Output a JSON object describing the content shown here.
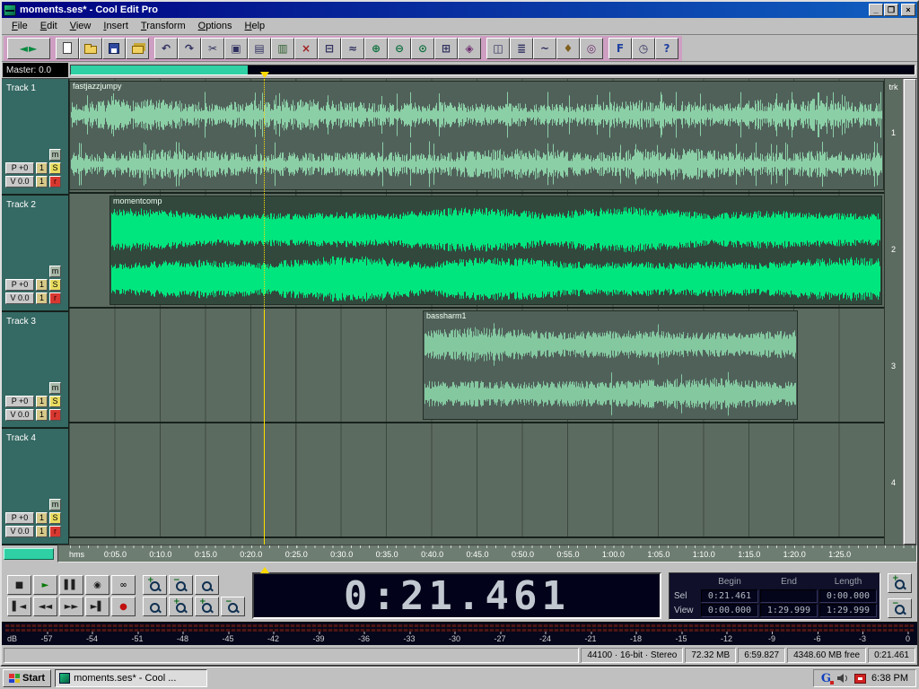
{
  "window": {
    "title": "moments.ses* - Cool Edit Pro",
    "minimize": "_",
    "maximize": "❐",
    "close": "×"
  },
  "menu": [
    "File",
    "Edit",
    "View",
    "Insert",
    "Transform",
    "Options",
    "Help"
  ],
  "toolbar": {
    "groups": [
      {
        "name": "view",
        "buttons": [
          {
            "name": "multitrack-view-toggle",
            "glyph": "◄►",
            "color": "#0a8a40",
            "wide": true
          }
        ]
      },
      {
        "name": "file",
        "buttons": [
          {
            "name": "new-session",
            "icon": "page"
          },
          {
            "name": "open-file",
            "icon": "folder"
          },
          {
            "name": "save-session",
            "icon": "floppy"
          },
          {
            "name": "save-all",
            "icon": "folders"
          }
        ]
      },
      {
        "name": "edit",
        "buttons": [
          {
            "name": "undo",
            "glyph": "↶",
            "color": "#303060"
          },
          {
            "name": "redo",
            "glyph": "↷",
            "color": "#303060"
          },
          {
            "name": "cut",
            "glyph": "✂",
            "color": "#303060"
          },
          {
            "name": "copy",
            "glyph": "▣",
            "color": "#303060"
          },
          {
            "name": "paste",
            "glyph": "▤",
            "color": "#303060"
          },
          {
            "name": "mix-paste",
            "glyph": "▥",
            "color": "#306030"
          },
          {
            "name": "delete-selection",
            "glyph": "×",
            "color": "#a02020"
          },
          {
            "name": "trim",
            "glyph": "⊟",
            "color": "#303060"
          },
          {
            "name": "crossfade",
            "glyph": "≈",
            "color": "#303060"
          },
          {
            "name": "zoom-in",
            "glyph": "⊕",
            "color": "#107040"
          },
          {
            "name": "zoom-out",
            "glyph": "⊖",
            "color": "#107040"
          },
          {
            "name": "zoom-to-selection",
            "glyph": "⊙",
            "color": "#107040"
          },
          {
            "name": "snapping",
            "glyph": "⊞",
            "color": "#303060"
          },
          {
            "name": "group-blocks",
            "glyph": "◈",
            "color": "#703070"
          }
        ]
      },
      {
        "name": "windows",
        "buttons": [
          {
            "name": "organizer-window",
            "glyph": "◫",
            "color": "#303060"
          },
          {
            "name": "mixers-window",
            "glyph": "≣",
            "color": "#303060"
          },
          {
            "name": "envelopes-window",
            "glyph": "~",
            "color": "#303060"
          },
          {
            "name": "cue-list-window",
            "glyph": "♦",
            "color": "#806020"
          },
          {
            "name": "cd-player-window",
            "glyph": "◎",
            "color": "#703070"
          }
        ]
      },
      {
        "name": "help",
        "buttons": [
          {
            "name": "favorites",
            "glyph": "F",
            "color": "#2040a0"
          },
          {
            "name": "session-clock",
            "glyph": "◷",
            "color": "#303060"
          },
          {
            "name": "help",
            "glyph": "?",
            "color": "#2040a0"
          }
        ]
      }
    ]
  },
  "master": {
    "label": "Master: 0.0",
    "progress_pct": 21
  },
  "track_buttons": {
    "mute": "m",
    "bus": "1",
    "solo": "S",
    "record": "r"
  },
  "trk_header": "trk",
  "tracks": [
    {
      "name": "Track 1",
      "pan": "P +0",
      "vol": "V 0.0",
      "num": "1",
      "clip": {
        "label": "fastjazzjumpy"
      }
    },
    {
      "name": "Track 2",
      "pan": "P +0",
      "vol": "V 0.0",
      "num": "2",
      "clip": {
        "label": "momentcomp"
      }
    },
    {
      "name": "Track 3",
      "pan": "P +0",
      "vol": "V 0.0",
      "num": "3",
      "clip": {
        "label": "bassharm1"
      }
    },
    {
      "name": "Track 4",
      "pan": "P +0",
      "vol": "V 0.0",
      "num": "4"
    }
  ],
  "ruler": {
    "unit": "hms",
    "ticks": [
      "0:05.0",
      "0:10.0",
      "0:15.0",
      "0:20.0",
      "0:25.0",
      "0:30.0",
      "0:35.0",
      "0:40.0",
      "0:45.0",
      "0:50.0",
      "0:55.0",
      "1:00.0",
      "1:05.0",
      "1:10.0",
      "1:15.0",
      "1:20.0",
      "1:25.0"
    ]
  },
  "transport": {
    "row1": [
      {
        "name": "stop-button",
        "glyph": "■",
        "color": "#202020"
      },
      {
        "name": "play-button",
        "glyph": "►",
        "color": "#0a7a0a"
      },
      {
        "name": "pause-button",
        "glyph": "▌▌",
        "color": "#202020"
      },
      {
        "name": "play-to-end-button",
        "glyph": "◉",
        "color": "#202020"
      },
      {
        "name": "loop-button",
        "glyph": "∞",
        "color": "#202020"
      }
    ],
    "row2": [
      {
        "name": "go-to-beginning-button",
        "glyph": "▌◄",
        "color": "#202020"
      },
      {
        "name": "rewind-button",
        "glyph": "◄◄",
        "color": "#202020"
      },
      {
        "name": "fast-forward-button",
        "glyph": "►►",
        "color": "#202020"
      },
      {
        "name": "go-to-end-button",
        "glyph": "►▌",
        "color": "#202020"
      },
      {
        "name": "record-button",
        "glyph": "●",
        "color": "#c01010"
      }
    ]
  },
  "zoom": {
    "row1": [
      "zoom-in-horizontal",
      "zoom-out-horizontal",
      "zoom-full"
    ],
    "row2": [
      "zoom-to-selection",
      "zoom-in-left-edge",
      "zoom-in-right-edge",
      "zoom-out-full"
    ],
    "vertical": [
      "zoom-in-vertical",
      "zoom-out-vertical"
    ]
  },
  "time_display": "0:21.461",
  "selection_panel": {
    "headers": [
      "Begin",
      "End",
      "Length"
    ],
    "rows": [
      {
        "label": "Sel",
        "values": [
          "0:21.461",
          "",
          "0:00.000"
        ]
      },
      {
        "label": "View",
        "values": [
          "0:00.000",
          "1:29.999",
          "1:29.999"
        ]
      }
    ]
  },
  "meter": {
    "unit": "dB",
    "scale": [
      "-57",
      "-54",
      "-51",
      "-48",
      "-45",
      "-42",
      "-39",
      "-36",
      "-33",
      "-30",
      "-27",
      "-24",
      "-21",
      "-18",
      "-15",
      "-12",
      "-9",
      "-6",
      "-3",
      "0"
    ]
  },
  "status_bar": [
    "44100 · 16-bit · Stereo",
    "72.32 MB",
    "6:59.827",
    "4348.60 MB free",
    "0:21.461"
  ],
  "taskbar": {
    "start": "Start",
    "task": "moments.ses* - Cool ...",
    "time": "6:38 PM"
  }
}
